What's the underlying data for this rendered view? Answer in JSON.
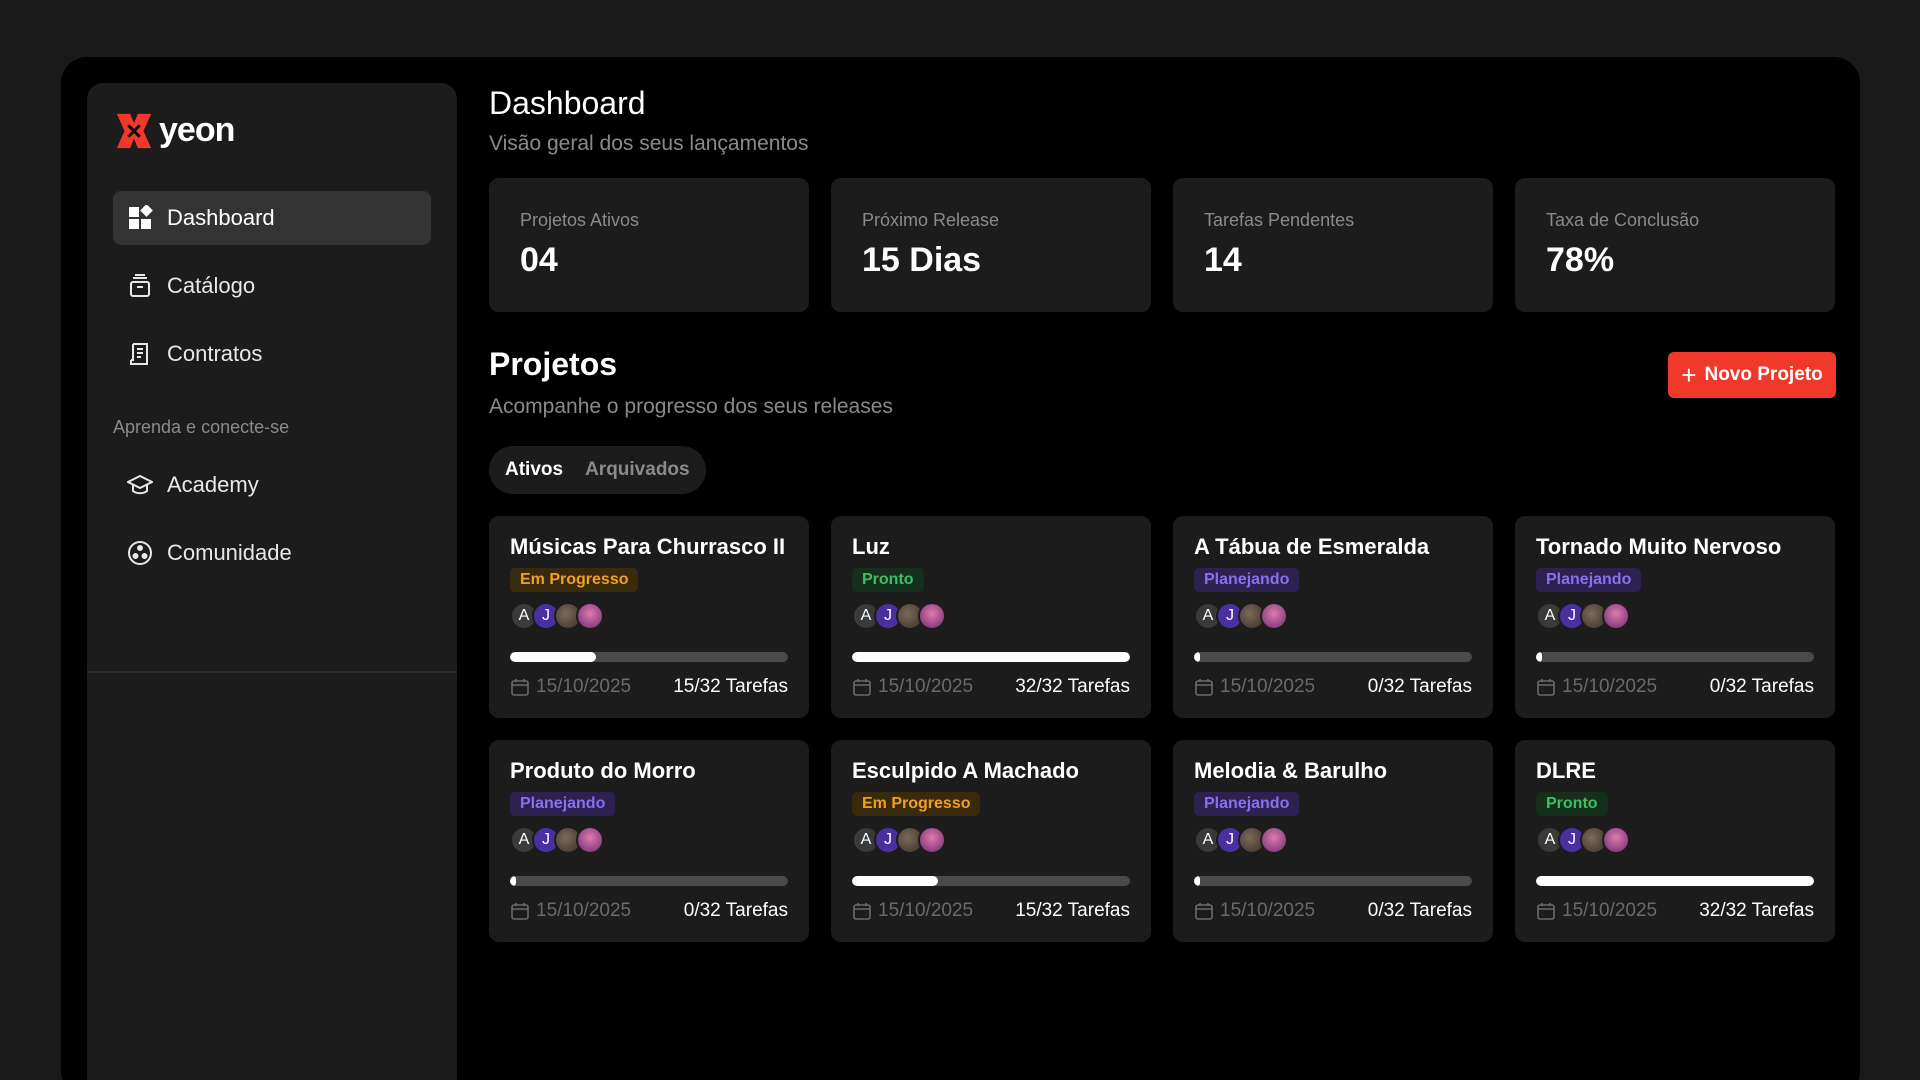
{
  "brand": {
    "name": "yeon",
    "accent": "#f0382b"
  },
  "sidebar": {
    "items": [
      {
        "label": "Dashboard",
        "icon": "dashboard-icon",
        "active": true
      },
      {
        "label": "Catálogo",
        "icon": "catalog-icon",
        "active": false
      },
      {
        "label": "Contratos",
        "icon": "contracts-icon",
        "active": false
      }
    ],
    "section_label": "Aprenda e conecte-se",
    "learn_items": [
      {
        "label": "Academy",
        "icon": "graduation-cap-icon"
      },
      {
        "label": "Comunidade",
        "icon": "community-icon"
      }
    ]
  },
  "header": {
    "title": "Dashboard",
    "subtitle": "Visão geral dos seus lançamentos"
  },
  "stats": [
    {
      "label": "Projetos Ativos",
      "value": "04"
    },
    {
      "label": "Próximo Release",
      "value": "15 Dias"
    },
    {
      "label": "Tarefas Pendentes",
      "value": "14"
    },
    {
      "label": "Taxa de Conclusão",
      "value": "78%"
    }
  ],
  "projects": {
    "title": "Projetos",
    "subtitle": "Acompanhe o progresso dos seus releases",
    "new_button": "Novo Projeto",
    "tabs": [
      {
        "label": "Ativos",
        "active": true
      },
      {
        "label": "Arquivados",
        "active": false
      }
    ],
    "cards": [
      {
        "title": "Músicas Para Churrasco II",
        "status": "Em Progresso",
        "status_type": "progress",
        "progress": 0.31,
        "date": "15/10/2025",
        "tasks": "15/32 Tarefas"
      },
      {
        "title": "Luz",
        "status": "Pronto",
        "status_type": "ready",
        "progress": 1.0,
        "date": "15/10/2025",
        "tasks": "32/32 Tarefas"
      },
      {
        "title": "A Tábua de Esmeralda",
        "status": "Planejando",
        "status_type": "plan",
        "progress": 0.0,
        "date": "15/10/2025",
        "tasks": "0/32 Tarefas"
      },
      {
        "title": "Tornado Muito Nervoso",
        "status": "Planejando",
        "status_type": "plan",
        "progress": 0.0,
        "date": "15/10/2025",
        "tasks": "0/32 Tarefas"
      },
      {
        "title": "Produto do Morro",
        "status": "Planejando",
        "status_type": "plan",
        "progress": 0.0,
        "date": "15/10/2025",
        "tasks": "0/32 Tarefas"
      },
      {
        "title": "Esculpido A Machado",
        "status": "Em Progresso",
        "status_type": "progress",
        "progress": 0.31,
        "date": "15/10/2025",
        "tasks": "15/32 Tarefas"
      },
      {
        "title": "Melodia & Barulho",
        "status": "Planejando",
        "status_type": "plan",
        "progress": 0.0,
        "date": "15/10/2025",
        "tasks": "0/32 Tarefas"
      },
      {
        "title": "DLRE",
        "status": "Pronto",
        "status_type": "ready",
        "progress": 1.0,
        "date": "15/10/2025",
        "tasks": "32/32 Tarefas"
      }
    ],
    "avatars": [
      {
        "initial": "A",
        "kind": "a"
      },
      {
        "initial": "J",
        "kind": "j"
      },
      {
        "initial": "",
        "kind": "p1"
      },
      {
        "initial": "",
        "kind": "p2"
      }
    ]
  }
}
